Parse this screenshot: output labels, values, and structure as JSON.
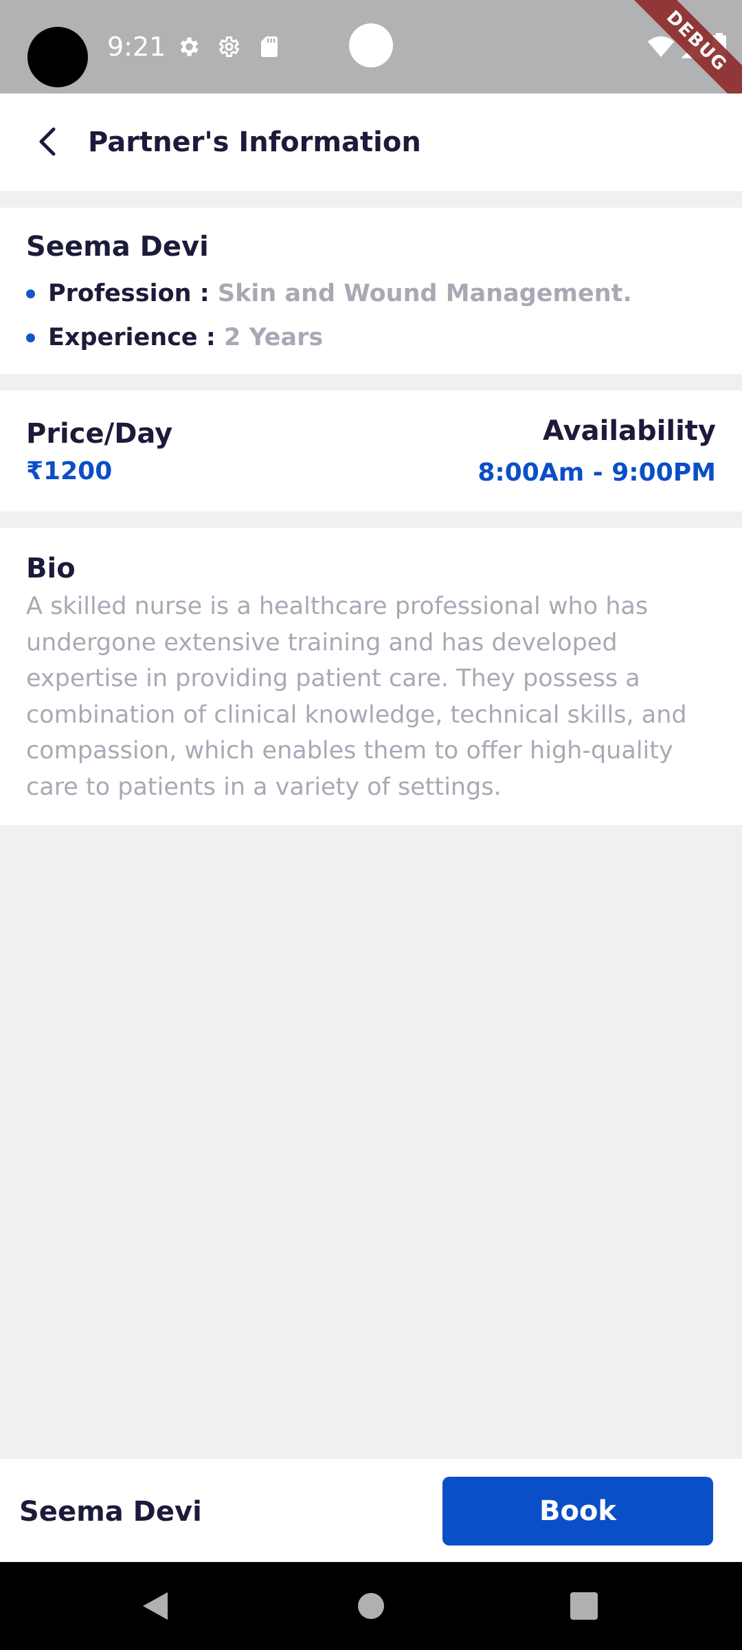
{
  "status_bar": {
    "time": "9:21",
    "icons": [
      "settings-icon",
      "settings-outline-icon",
      "sd-card-icon",
      "wifi-icon",
      "signal-icon",
      "battery-icon"
    ],
    "debug_banner": "DEBUG",
    "color": "#b2b2b2"
  },
  "app_bar": {
    "title": "Partner's Information",
    "back_icon": "back-arrow-icon"
  },
  "partner": {
    "name": "Seema Devi",
    "details": [
      {
        "label": "Profession : ",
        "value": "Skin and Wound Management."
      },
      {
        "label": "Experience : ",
        "value": "2 Years"
      }
    ]
  },
  "pricing": {
    "price_label": "Price/Day",
    "price_value": "₹1200",
    "availability_label": "Availability",
    "availability_value": "8:00Am - 9:00PM"
  },
  "bio": {
    "title": "Bio",
    "text": "A skilled nurse is a healthcare professional who has undergone extensive training and has developed expertise in providing patient care. They possess a combination of clinical knowledge, technical skills, and compassion, which enables them to offer high-quality care to patients in a variety of settings."
  },
  "bottom_bar": {
    "name": "Seema Devi",
    "book_label": "Book"
  },
  "colors": {
    "primary": "#0b4fc8",
    "text_dark": "#1c1b3a",
    "text_muted": "#a9a8b5",
    "background": "#f0f0f0"
  },
  "nav_bar": {
    "icons": [
      "back-triangle-icon",
      "home-circle-icon",
      "recents-square-icon"
    ]
  }
}
